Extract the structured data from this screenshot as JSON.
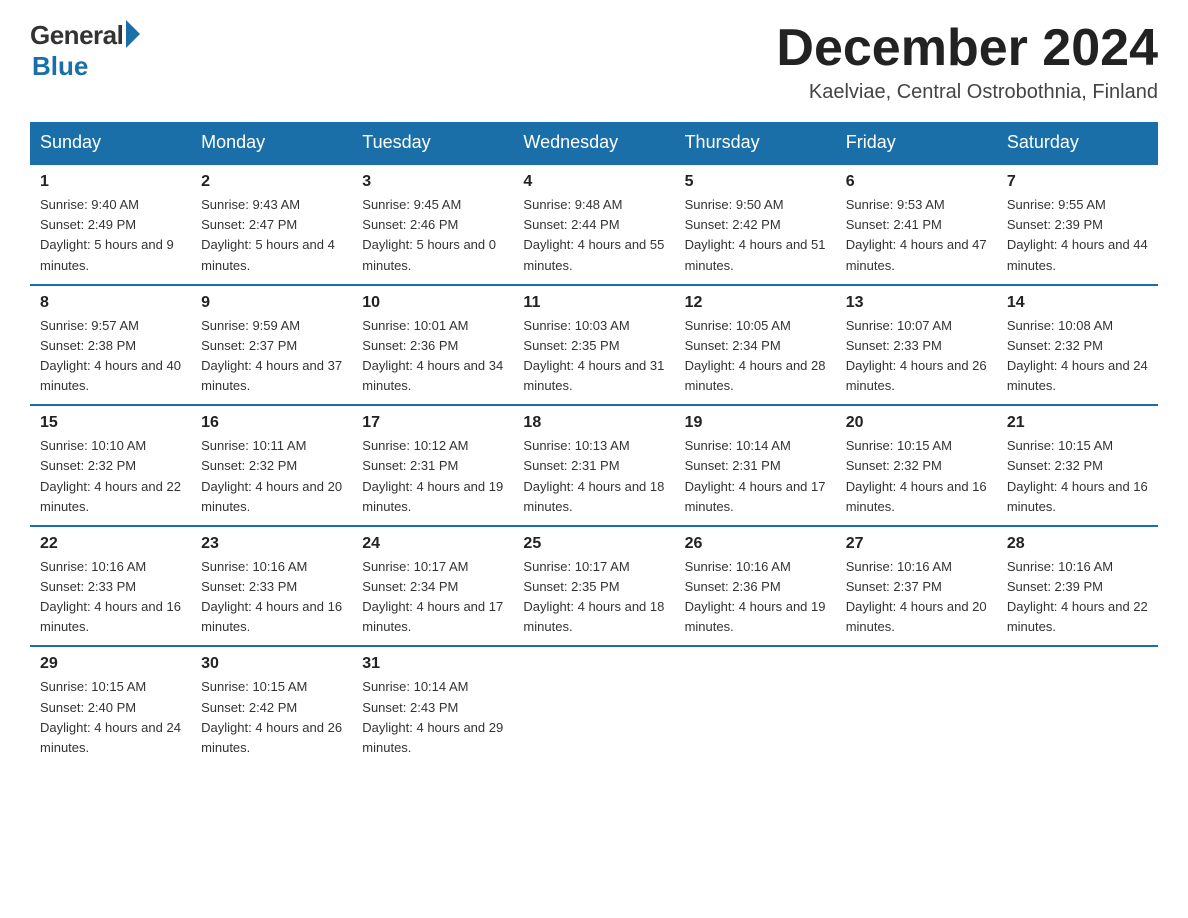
{
  "header": {
    "logo_general": "General",
    "logo_blue": "Blue",
    "month_title": "December 2024",
    "location": "Kaelviae, Central Ostrobothnia, Finland"
  },
  "days_of_week": [
    "Sunday",
    "Monday",
    "Tuesday",
    "Wednesday",
    "Thursday",
    "Friday",
    "Saturday"
  ],
  "weeks": [
    [
      {
        "day": "1",
        "sunrise": "9:40 AM",
        "sunset": "2:49 PM",
        "daylight": "5 hours and 9 minutes."
      },
      {
        "day": "2",
        "sunrise": "9:43 AM",
        "sunset": "2:47 PM",
        "daylight": "5 hours and 4 minutes."
      },
      {
        "day": "3",
        "sunrise": "9:45 AM",
        "sunset": "2:46 PM",
        "daylight": "5 hours and 0 minutes."
      },
      {
        "day": "4",
        "sunrise": "9:48 AM",
        "sunset": "2:44 PM",
        "daylight": "4 hours and 55 minutes."
      },
      {
        "day": "5",
        "sunrise": "9:50 AM",
        "sunset": "2:42 PM",
        "daylight": "4 hours and 51 minutes."
      },
      {
        "day": "6",
        "sunrise": "9:53 AM",
        "sunset": "2:41 PM",
        "daylight": "4 hours and 47 minutes."
      },
      {
        "day": "7",
        "sunrise": "9:55 AM",
        "sunset": "2:39 PM",
        "daylight": "4 hours and 44 minutes."
      }
    ],
    [
      {
        "day": "8",
        "sunrise": "9:57 AM",
        "sunset": "2:38 PM",
        "daylight": "4 hours and 40 minutes."
      },
      {
        "day": "9",
        "sunrise": "9:59 AM",
        "sunset": "2:37 PM",
        "daylight": "4 hours and 37 minutes."
      },
      {
        "day": "10",
        "sunrise": "10:01 AM",
        "sunset": "2:36 PM",
        "daylight": "4 hours and 34 minutes."
      },
      {
        "day": "11",
        "sunrise": "10:03 AM",
        "sunset": "2:35 PM",
        "daylight": "4 hours and 31 minutes."
      },
      {
        "day": "12",
        "sunrise": "10:05 AM",
        "sunset": "2:34 PM",
        "daylight": "4 hours and 28 minutes."
      },
      {
        "day": "13",
        "sunrise": "10:07 AM",
        "sunset": "2:33 PM",
        "daylight": "4 hours and 26 minutes."
      },
      {
        "day": "14",
        "sunrise": "10:08 AM",
        "sunset": "2:32 PM",
        "daylight": "4 hours and 24 minutes."
      }
    ],
    [
      {
        "day": "15",
        "sunrise": "10:10 AM",
        "sunset": "2:32 PM",
        "daylight": "4 hours and 22 minutes."
      },
      {
        "day": "16",
        "sunrise": "10:11 AM",
        "sunset": "2:32 PM",
        "daylight": "4 hours and 20 minutes."
      },
      {
        "day": "17",
        "sunrise": "10:12 AM",
        "sunset": "2:31 PM",
        "daylight": "4 hours and 19 minutes."
      },
      {
        "day": "18",
        "sunrise": "10:13 AM",
        "sunset": "2:31 PM",
        "daylight": "4 hours and 18 minutes."
      },
      {
        "day": "19",
        "sunrise": "10:14 AM",
        "sunset": "2:31 PM",
        "daylight": "4 hours and 17 minutes."
      },
      {
        "day": "20",
        "sunrise": "10:15 AM",
        "sunset": "2:32 PM",
        "daylight": "4 hours and 16 minutes."
      },
      {
        "day": "21",
        "sunrise": "10:15 AM",
        "sunset": "2:32 PM",
        "daylight": "4 hours and 16 minutes."
      }
    ],
    [
      {
        "day": "22",
        "sunrise": "10:16 AM",
        "sunset": "2:33 PM",
        "daylight": "4 hours and 16 minutes."
      },
      {
        "day": "23",
        "sunrise": "10:16 AM",
        "sunset": "2:33 PM",
        "daylight": "4 hours and 16 minutes."
      },
      {
        "day": "24",
        "sunrise": "10:17 AM",
        "sunset": "2:34 PM",
        "daylight": "4 hours and 17 minutes."
      },
      {
        "day": "25",
        "sunrise": "10:17 AM",
        "sunset": "2:35 PM",
        "daylight": "4 hours and 18 minutes."
      },
      {
        "day": "26",
        "sunrise": "10:16 AM",
        "sunset": "2:36 PM",
        "daylight": "4 hours and 19 minutes."
      },
      {
        "day": "27",
        "sunrise": "10:16 AM",
        "sunset": "2:37 PM",
        "daylight": "4 hours and 20 minutes."
      },
      {
        "day": "28",
        "sunrise": "10:16 AM",
        "sunset": "2:39 PM",
        "daylight": "4 hours and 22 minutes."
      }
    ],
    [
      {
        "day": "29",
        "sunrise": "10:15 AM",
        "sunset": "2:40 PM",
        "daylight": "4 hours and 24 minutes."
      },
      {
        "day": "30",
        "sunrise": "10:15 AM",
        "sunset": "2:42 PM",
        "daylight": "4 hours and 26 minutes."
      },
      {
        "day": "31",
        "sunrise": "10:14 AM",
        "sunset": "2:43 PM",
        "daylight": "4 hours and 29 minutes."
      },
      null,
      null,
      null,
      null
    ]
  ]
}
